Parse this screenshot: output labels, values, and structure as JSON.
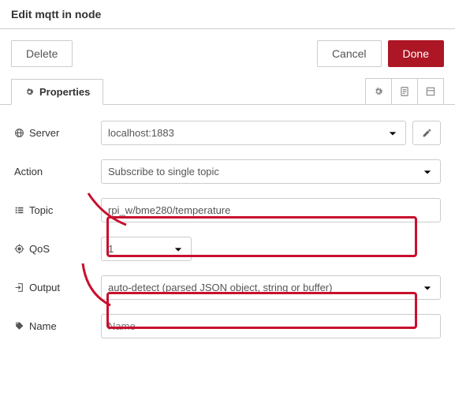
{
  "header": {
    "title": "Edit mqtt in node"
  },
  "buttons": {
    "delete": "Delete",
    "cancel": "Cancel",
    "done": "Done"
  },
  "tabs": {
    "properties": "Properties"
  },
  "form": {
    "server": {
      "label": "Server",
      "value": "localhost:1883"
    },
    "action": {
      "label": "Action",
      "value": "Subscribe to single topic"
    },
    "topic": {
      "label": "Topic",
      "value": "rpi_w/bme280/temperature"
    },
    "qos": {
      "label": "QoS",
      "value": "1"
    },
    "output": {
      "label": "Output",
      "value": "auto-detect (parsed JSON object, string or buffer)"
    },
    "name": {
      "label": "Name",
      "placeholder": "Name",
      "value": ""
    }
  }
}
